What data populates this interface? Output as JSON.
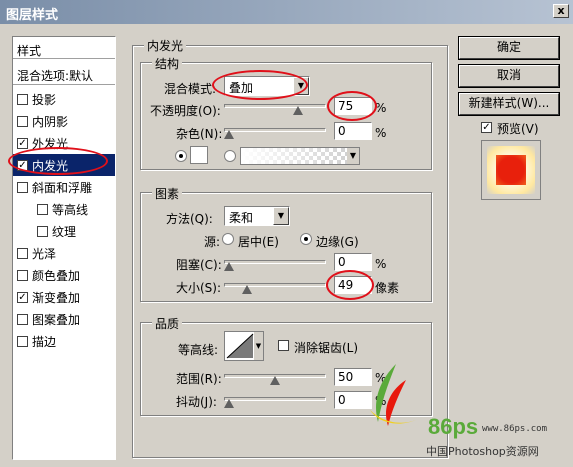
{
  "window": {
    "title": "图层样式",
    "close_glyph": "x"
  },
  "styles_panel": {
    "header": "样式",
    "blend_options": "混合选项:默认",
    "items": [
      {
        "label": "投影",
        "checked": false,
        "sub": false
      },
      {
        "label": "内阴影",
        "checked": false,
        "sub": false
      },
      {
        "label": "外发光",
        "checked": true,
        "sub": false
      },
      {
        "label": "内发光",
        "checked": true,
        "sub": false,
        "selected": true
      },
      {
        "label": "斜面和浮雕",
        "checked": false,
        "sub": false
      },
      {
        "label": "等高线",
        "checked": false,
        "sub": true
      },
      {
        "label": "纹理",
        "checked": false,
        "sub": true
      },
      {
        "label": "光泽",
        "checked": false,
        "sub": false
      },
      {
        "label": "颜色叠加",
        "checked": false,
        "sub": false
      },
      {
        "label": "渐变叠加",
        "checked": true,
        "sub": false
      },
      {
        "label": "图案叠加",
        "checked": false,
        "sub": false
      },
      {
        "label": "描边",
        "checked": false,
        "sub": false
      }
    ]
  },
  "inner_glow": {
    "title": "内发光",
    "structure": {
      "title": "结构",
      "blend_mode_label": "混合模式:",
      "blend_mode_value": "叠加",
      "opacity_label": "不透明度(O):",
      "opacity_value": "75",
      "opacity_unit": "%",
      "opacity_level": 0.75,
      "noise_label": "杂色(N):",
      "noise_value": "0",
      "noise_unit": "%",
      "noise_level": 0
    },
    "elements": {
      "title": "图素",
      "method_label": "方法(Q):",
      "method_value": "柔和",
      "source_label": "源:",
      "source_center": "居中(E)",
      "source_edge": "边缘(G)",
      "choke_label": "阻塞(C):",
      "choke_value": "0",
      "choke_unit": "%",
      "choke_level": 0,
      "size_label": "大小(S):",
      "size_value": "49",
      "size_unit": "像素",
      "size_level": 0.2
    },
    "quality": {
      "title": "品质",
      "contour_label": "等高线:",
      "antialias_label": "消除锯齿(L)",
      "range_label": "范围(R):",
      "range_value": "50",
      "range_unit": "%",
      "range_level": 0.5,
      "jitter_label": "抖动(J):",
      "jitter_value": "0",
      "jitter_unit": "%",
      "jitter_level": 0
    }
  },
  "buttons": {
    "ok": "确定",
    "cancel": "取消",
    "new_style": "新建样式(W)...",
    "preview": "预览(V)"
  },
  "watermark": {
    "site": "www.86ps.com",
    "logo": "86ps",
    "caption": "中国Photoshop资源网"
  },
  "colors": {
    "selection": "#0a246a",
    "highlight_ring": "#e0101a",
    "preview_fill": "#e8200c",
    "glow": "#ffd080"
  }
}
